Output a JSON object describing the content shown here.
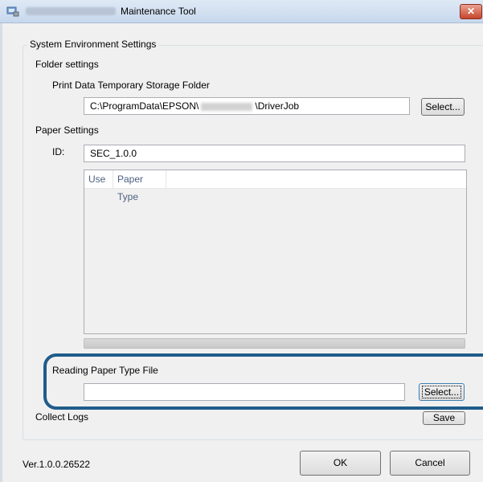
{
  "window": {
    "title": "Maintenance Tool",
    "close_glyph": "✕"
  },
  "group": {
    "label": "System Environment Settings"
  },
  "folder_settings": {
    "heading": "Folder settings",
    "storage_label": "Print Data Temporary Storage Folder",
    "path_prefix": "C:\\ProgramData\\EPSON\\",
    "path_suffix": "\\DriverJob",
    "select_label": "Select..."
  },
  "paper_settings": {
    "heading": "Paper Settings",
    "id_label": "ID:",
    "id_value": "SEC_1.0.0",
    "columns": [
      "Use",
      "Paper Type"
    ],
    "reading_label": "Reading Paper Type File",
    "reading_value": "",
    "select_label": "Select..."
  },
  "collect_logs": {
    "label": "Collect Logs",
    "save_label": "Save"
  },
  "footer": {
    "version": "Ver.1.0.0.26522",
    "ok_label": "OK",
    "cancel_label": "Cancel"
  },
  "colors": {
    "highlight": "#1f5c8b",
    "window_bg": "#f0f0f0",
    "title_bar": "#c7d8ed"
  }
}
